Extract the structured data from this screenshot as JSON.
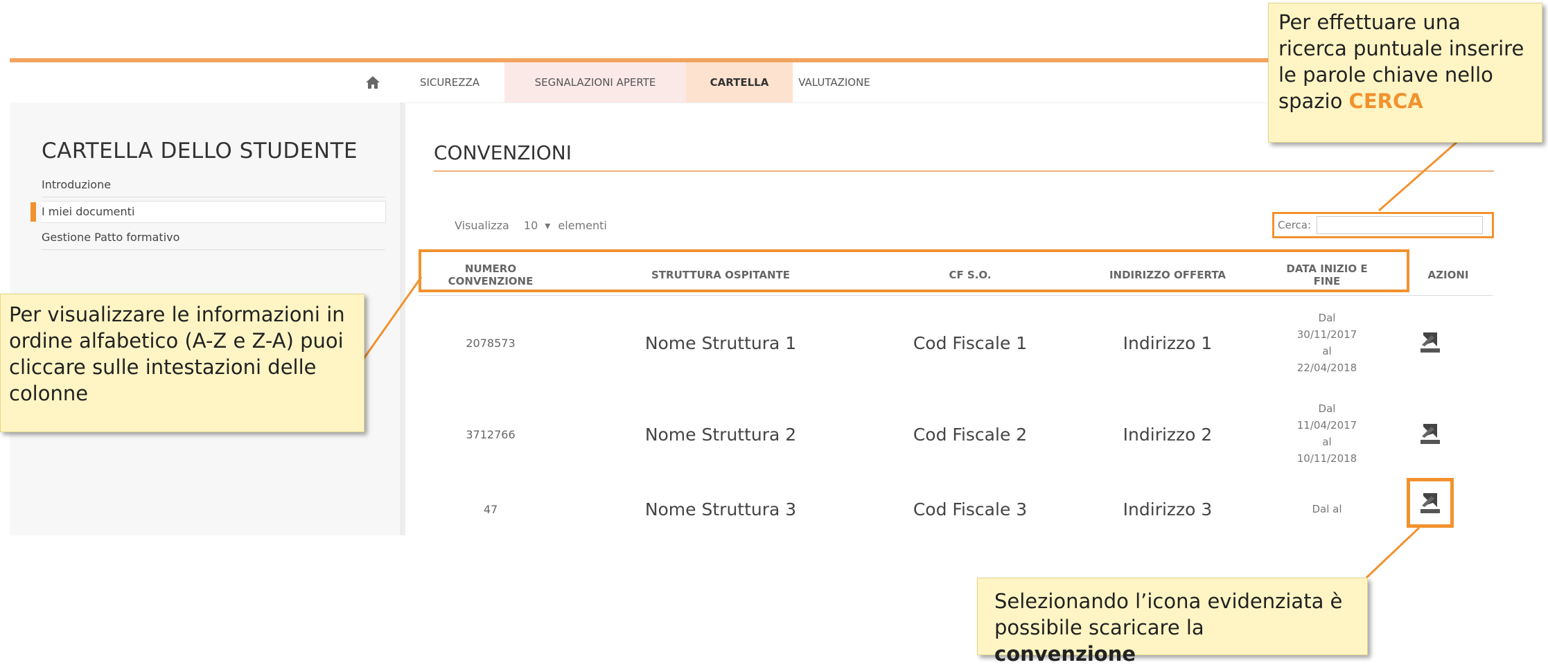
{
  "nav": {
    "tabs": [
      "SICUREZZA",
      "SEGNALAZIONI APERTE",
      "CARTELLA",
      "VALUTAZIONE"
    ],
    "active_tab": "CARTELLA"
  },
  "sidebar": {
    "title": "CARTELLA DELLO STUDENTE",
    "items": [
      "Introduzione",
      "I miei documenti",
      "Gestione Patto formativo"
    ],
    "active_item": "I miei documenti"
  },
  "main": {
    "title": "CONVENZIONI",
    "length_prefix": "Visualizza",
    "length_value": "10",
    "length_suffix": "elementi",
    "search_label": "Cerca:",
    "search_value": ""
  },
  "table": {
    "columns": [
      "NUMERO CONVENZIONE",
      "STRUTTURA OSPITANTE",
      "CF S.O.",
      "INDIRIZZO OFFERTA",
      "DATA INIZIO E FINE",
      "AZIONI"
    ],
    "rows": [
      {
        "numero": "2078573",
        "struttura": "Nome Struttura 1",
        "cf": "Cod Fiscale 1",
        "indirizzo": "Indirizzo 1",
        "date_lines": [
          "Dal",
          "30/11/2017",
          "al",
          "22/04/2018"
        ]
      },
      {
        "numero": "3712766",
        "struttura": "Nome Struttura 2",
        "cf": "Cod Fiscale 2",
        "indirizzo": "Indirizzo 2",
        "date_lines": [
          "Dal",
          "11/04/2017",
          "al",
          "10/11/2018"
        ]
      },
      {
        "numero": "47",
        "struttura": "Nome Struttura 3",
        "cf": "Cod Fiscale 3",
        "indirizzo": "Indirizzo 3",
        "date_lines": [
          "Dal al"
        ]
      }
    ]
  },
  "callouts": {
    "search": {
      "text": "Per effettuare una ricerca puntuale inserire le parole chiave nello spazio ",
      "highlight": "CERCA"
    },
    "sort": {
      "text": "Per visualizzare le informazioni in ordine alfabetico (A-Z e Z-A) puoi cliccare sulle intestazioni delle colonne"
    },
    "download": {
      "text": "Selezionando l’icona evidenziata è possibile scaricare la ",
      "highlight": "convenzione"
    }
  },
  "colors": {
    "accent": "#f2922e",
    "callout_bg": "#fff5c4"
  },
  "icons": [
    "home-icon",
    "download-icon"
  ]
}
